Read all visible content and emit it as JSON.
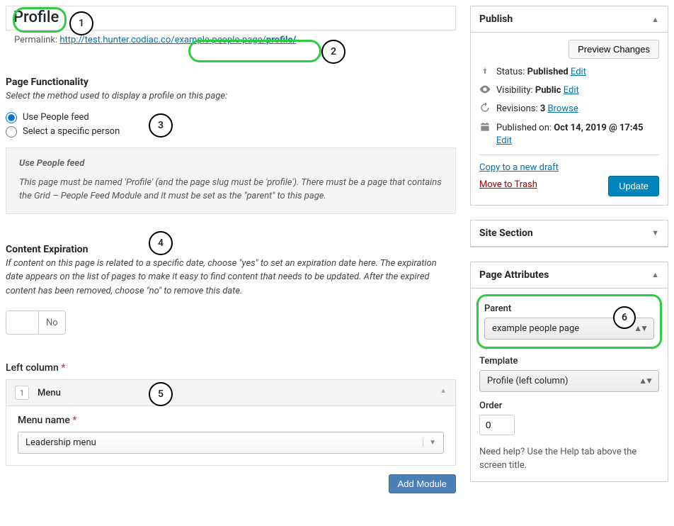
{
  "title": "Profile",
  "permalink": {
    "label": "Permalink:",
    "base": "http://test.hunter.codiac.co/example-people-page/",
    "slug": "profile/"
  },
  "callouts": {
    "c1": "1",
    "c2": "2",
    "c3": "3",
    "c4": "4",
    "c5": "5",
    "c6": "6"
  },
  "func": {
    "title": "Page Functionality",
    "desc": "Select the method used to display a profile on this page:",
    "opt1": "Use People feed",
    "opt2": "Select a specific person",
    "info_title": "Use People feed",
    "info_text": "This page must be named 'Profile' (and the page slug must be 'profile'). There must be a page that contains the Grid – People Feed Module and it must be set as the \"parent\" to this page."
  },
  "expire": {
    "title": "Content Expiration",
    "desc": "If content on this page is related to a specific date, choose \"yes\" to set an expiration date here. The expiration date appears on the list of pages to make it easy to find content that needs to be updated. After the expired content has been removed, choose \"no\" to remove this date.",
    "no": "No"
  },
  "leftcol": {
    "label": "Left column",
    "req": "*",
    "item_num": "1",
    "item_title": "Menu",
    "menu_label": "Menu name",
    "menu_req": "*",
    "menu_value": "Leadership menu",
    "add_module": "Add Module"
  },
  "publish": {
    "title": "Publish",
    "preview": "Preview Changes",
    "status_label": "Status:",
    "status_value": "Published",
    "status_edit": "Edit",
    "vis_label": "Visibility:",
    "vis_value": "Public",
    "vis_edit": "Edit",
    "rev_label": "Revisions:",
    "rev_value": "3",
    "rev_browse": "Browse",
    "pub_label": "Published on:",
    "pub_value": "Oct 14, 2019 @ 17:45",
    "pub_edit": "Edit",
    "copy": "Copy to a new draft",
    "trash": "Move to Trash",
    "update": "Update"
  },
  "site_section": {
    "title": "Site Section"
  },
  "attrs": {
    "title": "Page Attributes",
    "parent_label": "Parent",
    "parent_value": "example people page",
    "template_label": "Template",
    "template_value": "Profile (left column)",
    "order_label": "Order",
    "order_value": "0",
    "help": "Need help? Use the Help tab above the screen title."
  }
}
